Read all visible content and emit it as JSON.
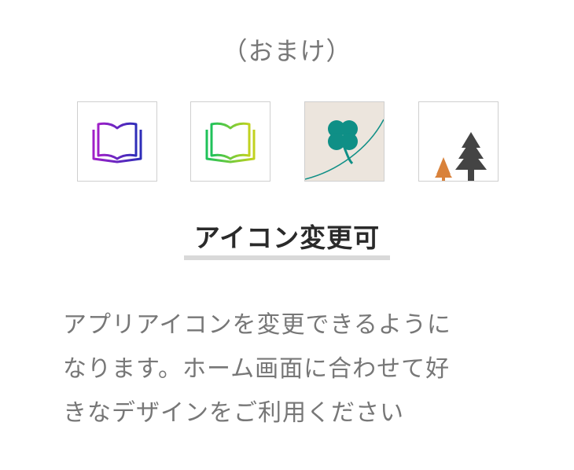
{
  "header": {
    "subtitle": "（おまけ）"
  },
  "icons": [
    {
      "name": "book-purple-icon",
      "colors": [
        "#a020c8",
        "#2e2db8"
      ]
    },
    {
      "name": "book-green-icon",
      "colors": [
        "#1fc25a",
        "#c2d21e"
      ]
    },
    {
      "name": "clover-icon",
      "colors": [
        "#0f8f86",
        "#ece5dd"
      ]
    },
    {
      "name": "trees-icon",
      "colors": [
        "#d9823b",
        "#444444"
      ]
    }
  ],
  "feature": {
    "title": "アイコン変更可",
    "description_lines": [
      "アプリアイコンを変更できるように",
      "なります。ホーム画面に合わせて好",
      "きなデザインをご利用ください"
    ]
  }
}
